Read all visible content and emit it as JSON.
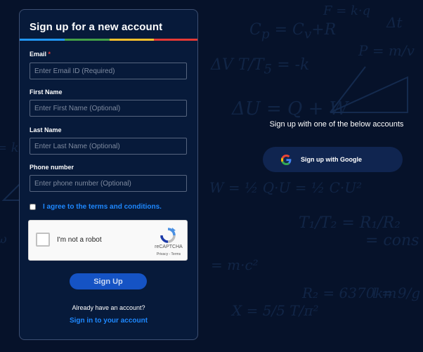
{
  "form": {
    "title": "Sign up for a new account",
    "stripe_colors": [
      "#2196f3",
      "#43a047",
      "#fbc02d",
      "#e53935"
    ],
    "fields": [
      {
        "label": "Email",
        "required_mark": "*",
        "placeholder": "Enter Email ID (Required)",
        "value": ""
      },
      {
        "label": "First Name",
        "placeholder": "Enter First Name (Optional)",
        "value": ""
      },
      {
        "label": "Last Name",
        "placeholder": "Enter Last Name (Optional)",
        "value": ""
      },
      {
        "label": "Phone number",
        "placeholder": "Enter phone number (Optional)",
        "value": ""
      }
    ],
    "terms_label": "I agree to the terms and conditions.",
    "terms_checked": false,
    "captcha": {
      "label": "I'm not a robot",
      "brand": "reCAPTCHA",
      "links": "Privacy - Terms"
    },
    "submit_label": "Sign Up",
    "already_text": "Already have an account?",
    "signin_label": "Sign in to your account"
  },
  "social": {
    "heading": "Sign up with one of the below accounts",
    "google_label": "Sign up with Google",
    "google_icon": "google-g-icon"
  },
  "colors": {
    "background": "#06122a",
    "card": "#071a3a",
    "accent": "#1e88ff",
    "button": "#1553c4"
  }
}
